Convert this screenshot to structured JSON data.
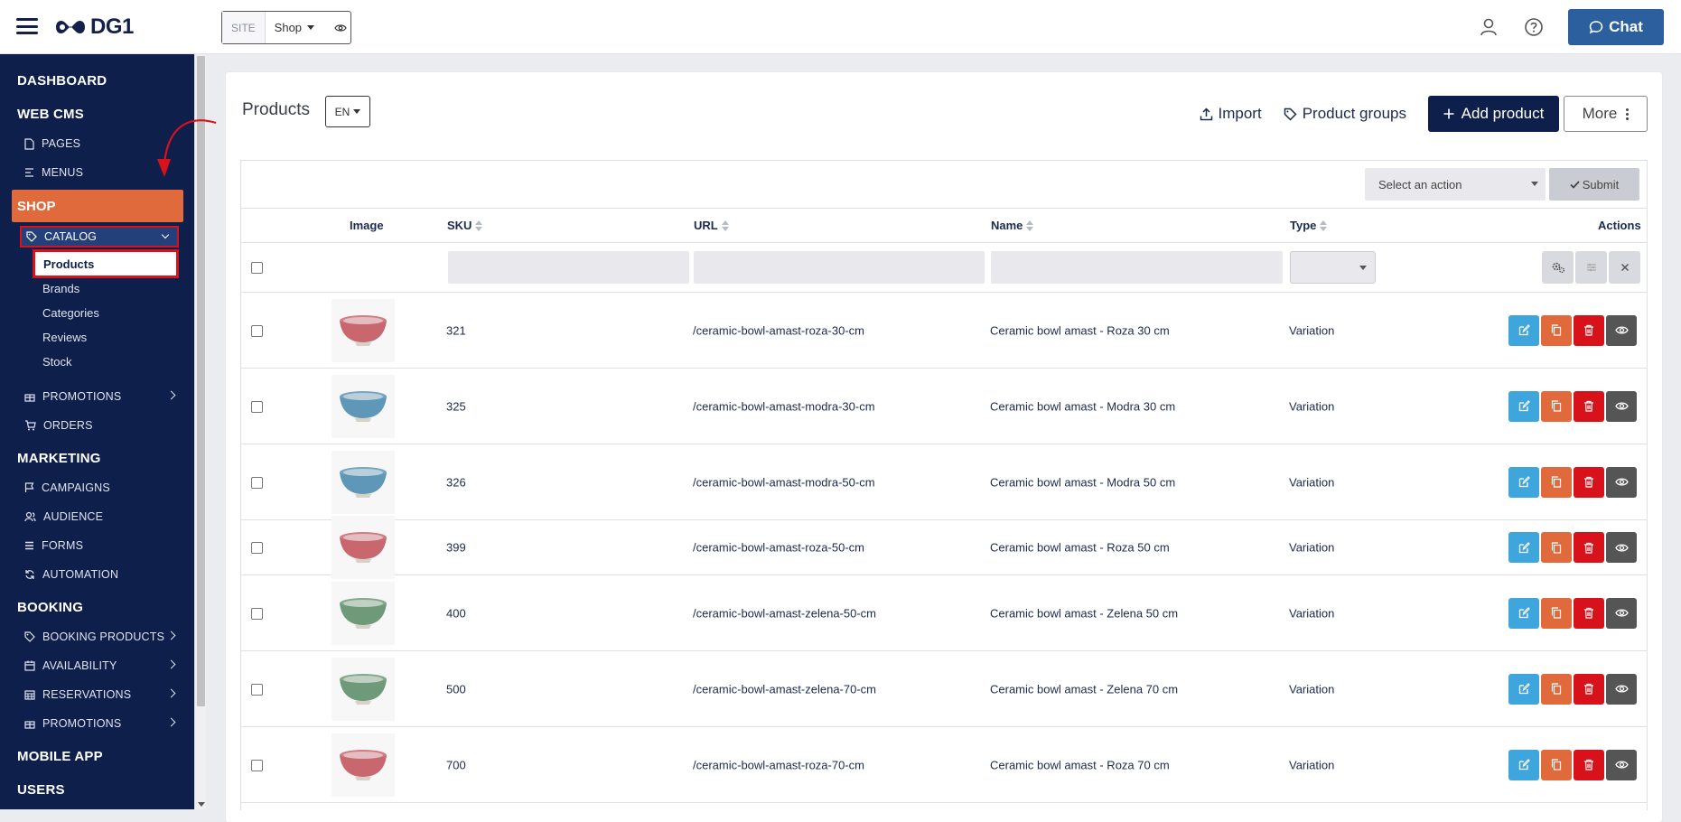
{
  "app": {
    "logo_text": "DG1",
    "site_label": "SITE",
    "site_value": "Shop",
    "chat_label": "Chat"
  },
  "sidebar": {
    "sections": {
      "dashboard": "DASHBOARD",
      "webcms": "WEB CMS",
      "shop": "SHOP",
      "marketing": "MARKETING",
      "booking": "BOOKING",
      "mobile": "MOBILE APP",
      "users": "USERS"
    },
    "webcms_items": [
      "PAGES",
      "MENUS"
    ],
    "shop_items": {
      "catalog": "CATALOG",
      "catalog_sub": [
        "Products",
        "Brands",
        "Categories",
        "Reviews",
        "Stock"
      ],
      "promotions": "PROMOTIONS",
      "orders": "ORDERS"
    },
    "marketing_items": [
      "CAMPAIGNS",
      "AUDIENCE",
      "FORMS",
      "AUTOMATION"
    ],
    "booking_items": [
      "BOOKING PRODUCTS",
      "AVAILABILITY",
      "RESERVATIONS",
      "PROMOTIONS"
    ]
  },
  "page": {
    "title": "Products",
    "lang": "EN",
    "import_label": "Import",
    "groups_label": "Product groups",
    "add_label": "Add product",
    "more_label": "More",
    "action_placeholder": "Select an action",
    "submit_label": "Submit"
  },
  "table": {
    "headers": {
      "image": "Image",
      "sku": "SKU",
      "url": "URL",
      "name": "Name",
      "type": "Type",
      "actions": "Actions"
    },
    "rows": [
      {
        "sku": "321",
        "url": "/ceramic-bowl-amast-roza-30-cm",
        "name": "Ceramic bowl amast - Roza 30 cm",
        "type": "Variation",
        "bowl_color": "#c9676f"
      },
      {
        "sku": "325",
        "url": "/ceramic-bowl-amast-modra-30-cm",
        "name": "Ceramic bowl amast - Modra 30 cm",
        "type": "Variation",
        "bowl_color": "#5f97b8"
      },
      {
        "sku": "326",
        "url": "/ceramic-bowl-amast-modra-50-cm",
        "name": "Ceramic bowl amast - Modra 50 cm",
        "type": "Variation",
        "bowl_color": "#5f97b8"
      },
      {
        "sku": "399",
        "url": "/ceramic-bowl-amast-roza-50-cm",
        "name": "Ceramic bowl amast - Roza 50 cm",
        "type": "Variation",
        "bowl_color": "#c9676f"
      },
      {
        "sku": "400",
        "url": "/ceramic-bowl-amast-zelena-50-cm",
        "name": "Ceramic bowl amast - Zelena 50 cm",
        "type": "Variation",
        "bowl_color": "#6f9a7a"
      },
      {
        "sku": "500",
        "url": "/ceramic-bowl-amast-zelena-70-cm",
        "name": "Ceramic bowl amast - Zelena 70 cm",
        "type": "Variation",
        "bowl_color": "#6f9a7a"
      },
      {
        "sku": "700",
        "url": "/ceramic-bowl-amast-roza-70-cm",
        "name": "Ceramic bowl amast - Roza 70 cm",
        "type": "Variation",
        "bowl_color": "#c9676f"
      }
    ]
  },
  "colors": {
    "sidebar_bg": "#0f1f4b",
    "shop_active": "#e06a3c",
    "highlight_border": "#d8121b",
    "edit": "#3fa6dd",
    "copy": "#e06a3c",
    "delete": "#d8121b",
    "view": "#555555"
  }
}
